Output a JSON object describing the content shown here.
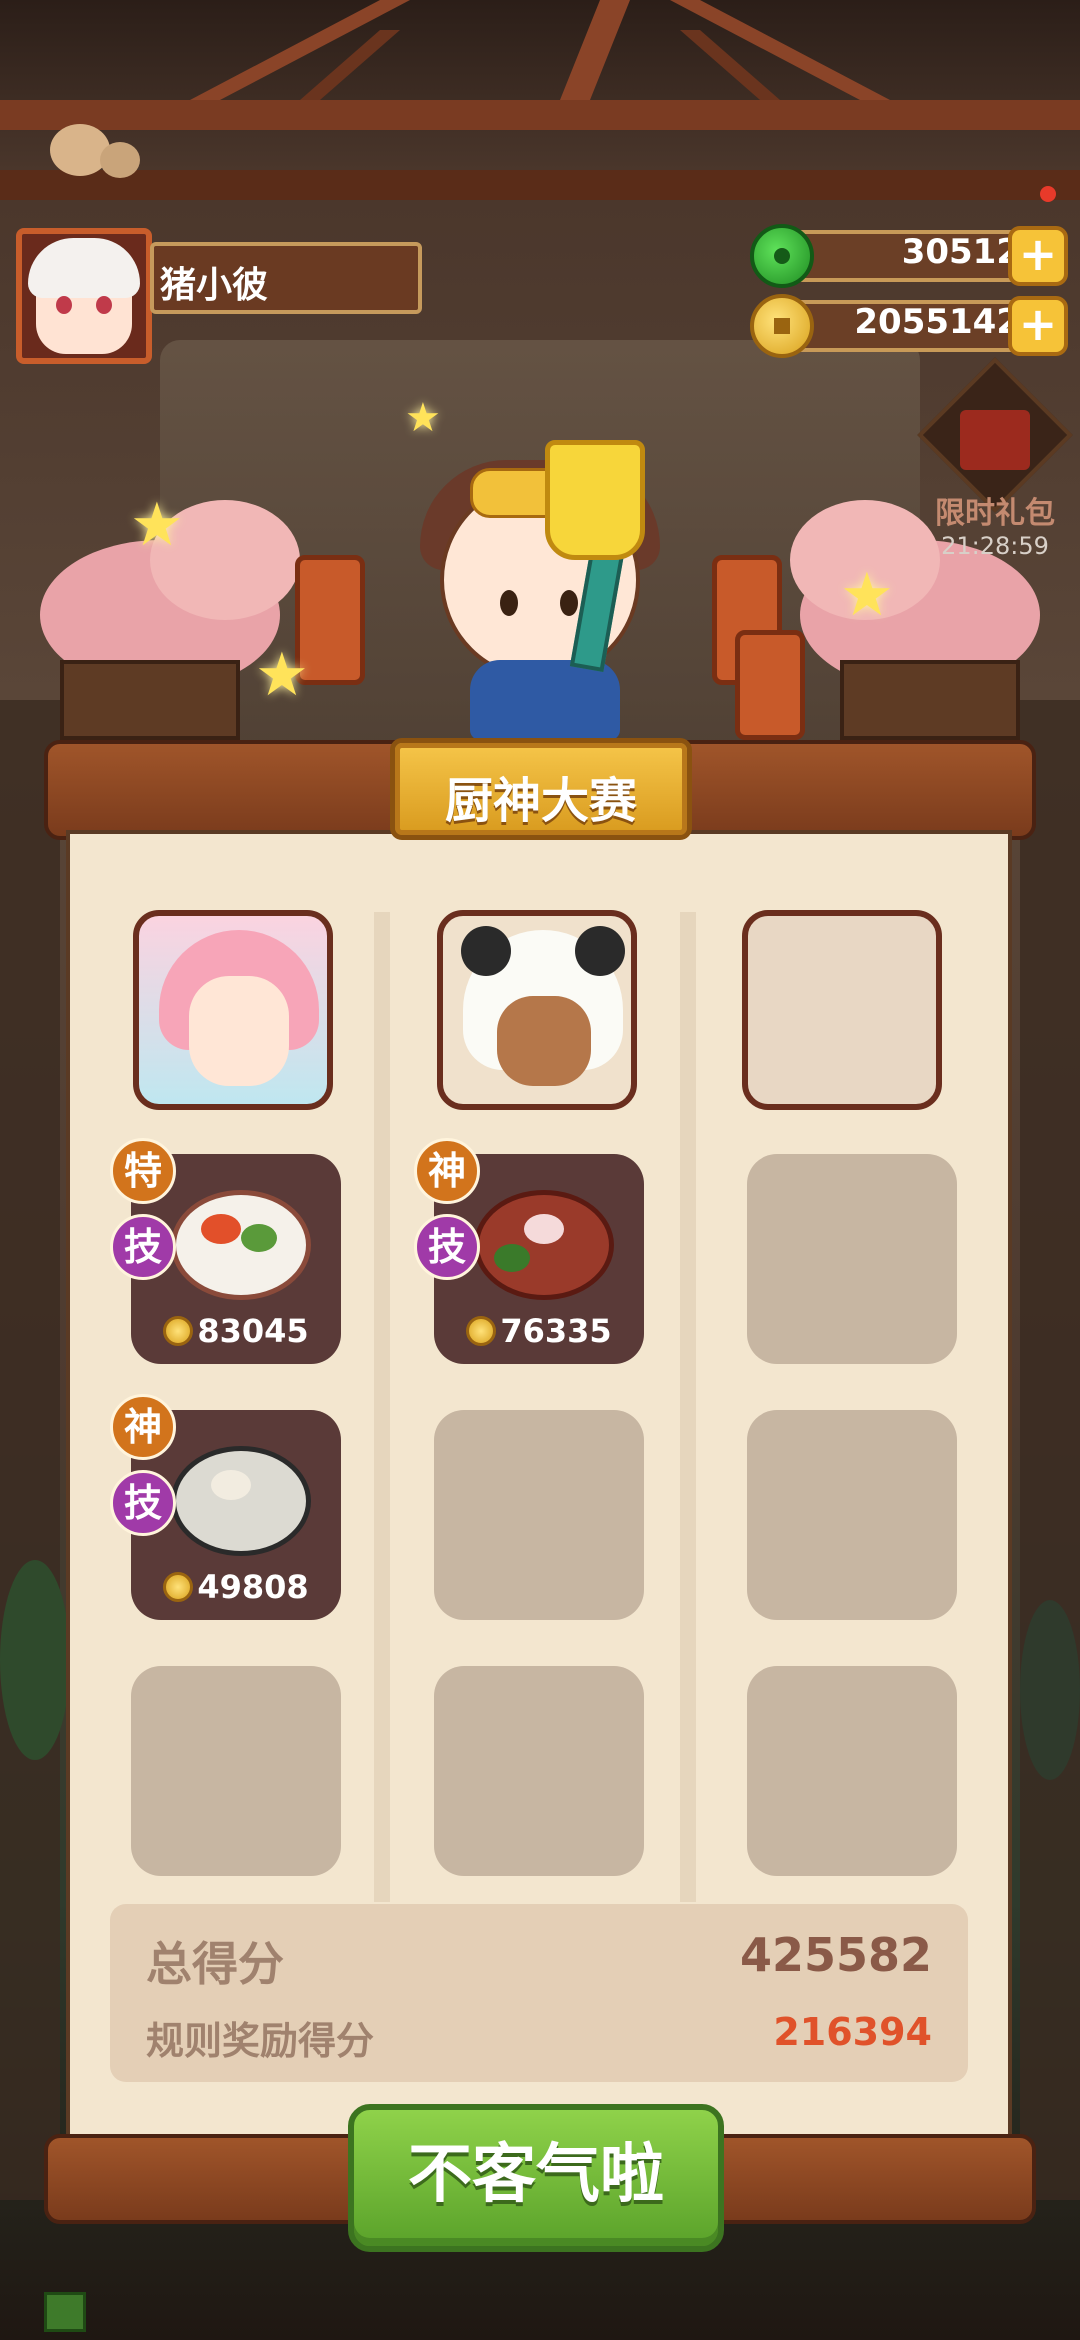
{
  "player": {
    "name": "猪小彼"
  },
  "currencies": {
    "jade": {
      "value": "30512",
      "icon": "jade-coin-icon"
    },
    "gold": {
      "value": "2055142",
      "icon": "gold-coin-icon"
    }
  },
  "gift": {
    "label": "限时礼包",
    "timer": "21:28:59"
  },
  "contest": {
    "title": "厨神大赛"
  },
  "columns": [
    {
      "chef": "chef-pink-hair",
      "dishes": [
        {
          "badges": [
            "特",
            "技"
          ],
          "price": "83045"
        },
        {
          "badges": [
            "神",
            "技"
          ],
          "price": "49808"
        }
      ]
    },
    {
      "chef": "chef-panda-hood",
      "dishes": [
        {
          "badges": [
            "神",
            "技"
          ],
          "price": "76335"
        }
      ]
    },
    {
      "chef": null,
      "dishes": []
    }
  ],
  "score": {
    "total_label": "总得分",
    "total_value": "425582",
    "bonus_label": "规则奖励得分",
    "bonus_value": "216394"
  },
  "colors": {
    "total": "#8a5a48",
    "bonus": "#e0522a",
    "button": "#6fb83a"
  },
  "button": {
    "label": "不客气啦"
  }
}
